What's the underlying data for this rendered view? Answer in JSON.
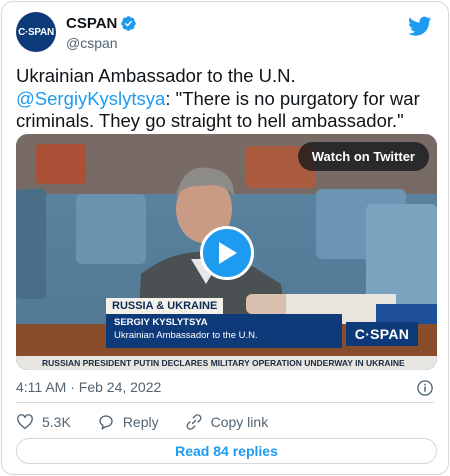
{
  "account": {
    "display_name": "CSPAN",
    "handle": "@cspan",
    "avatar_text_c": "C·",
    "avatar_text_span": "SPAN"
  },
  "tweet": {
    "text_before": "Ukrainian Ambassador to the U.N. ",
    "mention": "@SergiyKyslytsya",
    "text_after": ": \"There is no purgatory for war criminals. They go straight to hell ambassador.\"",
    "timestamp": "4:11 AM · Feb 24, 2022"
  },
  "media": {
    "watch_label": "Watch on Twitter",
    "topic": "RUSSIA & UKRAINE",
    "person_name": "SERGIY KYSLYTSYA",
    "person_title": "Ukrainian Ambassador to the U.N.",
    "bug": "C·SPAN",
    "ticker": "RUSSIAN PRESIDENT PUTIN DECLARES MILITARY OPERATION UNDERWAY IN UKRAINE"
  },
  "actions": {
    "like_count": "5.3K",
    "reply_label": "Reply",
    "copy_label": "Copy link"
  },
  "read_replies": "Read 84 replies",
  "colors": {
    "accent": "#1d9bf0",
    "text": "#0f1419",
    "muted": "#536471",
    "border": "#cfd9de",
    "cspan_blue": "#0f3a7a"
  },
  "icons": [
    "verified-badge-icon",
    "twitter-bird-icon",
    "play-icon",
    "info-icon",
    "heart-icon",
    "reply-bubble-icon",
    "link-icon"
  ]
}
